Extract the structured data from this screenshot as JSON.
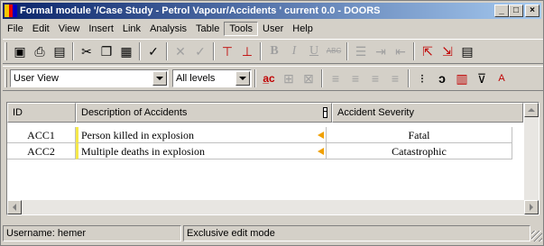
{
  "window": {
    "title": "Formal module '/Case Study - Petrol Vapour/Accidents ' current 0.0 - DOORS",
    "minimize_label": "_",
    "maximize_label": "□",
    "close_label": "×"
  },
  "menu": {
    "items": [
      "File",
      "Edit",
      "View",
      "Insert",
      "Link",
      "Analysis",
      "Table",
      "Tools",
      "User",
      "Help"
    ],
    "active": "Tools"
  },
  "toolbar1": {
    "icons": [
      "save-icon",
      "print-icon",
      "properties-icon",
      "cut-icon",
      "copy-icon",
      "paste-icon",
      "spellcheck-icon",
      "check-icon",
      "delete-icon",
      "accept-icon",
      "insert-above-icon",
      "insert-below-icon",
      "bold-icon",
      "italic-icon",
      "underline-icon",
      "strikethrough-icon",
      "bullet-list-icon",
      "indent-icon",
      "outdent-icon",
      "link-start-icon",
      "link-end-icon",
      "more-icon"
    ],
    "glyphs": {
      "save": "▣",
      "print": "⎙",
      "properties": "▤",
      "cut": "✂",
      "copy": "❐",
      "paste": "▦",
      "spellcheck": "✓",
      "check": "✔",
      "delete": "✕",
      "accept": "✓",
      "bold": "B",
      "italic": "I",
      "underline": "U",
      "strike": "ABC",
      "bullets": "☰",
      "indent": "⇥",
      "outdent": "⇤"
    }
  },
  "toolbar2": {
    "view_select": "User View",
    "level_select": "All levels",
    "glyphs": {
      "filter": "⊽",
      "links": "⇆",
      "align_left": "≡",
      "align_center": "≡",
      "align_right": "≡",
      "justify": "≡"
    }
  },
  "table": {
    "columns": [
      "ID",
      "Description of Accidents",
      "Accident Severity"
    ],
    "rows": [
      {
        "id": "ACC1",
        "description": "Person killed in explosion",
        "severity": "Fatal"
      },
      {
        "id": "ACC2",
        "description": "Multiple deaths in explosion",
        "severity": "Catastrophic"
      }
    ]
  },
  "status": {
    "username": "Username: hemer",
    "mode": "Exclusive edit mode"
  },
  "colors": {
    "title_start": "#0a246a",
    "title_end": "#a6caf0",
    "link_arrow": "#f0a000",
    "row_marker": "#f5e84a"
  }
}
